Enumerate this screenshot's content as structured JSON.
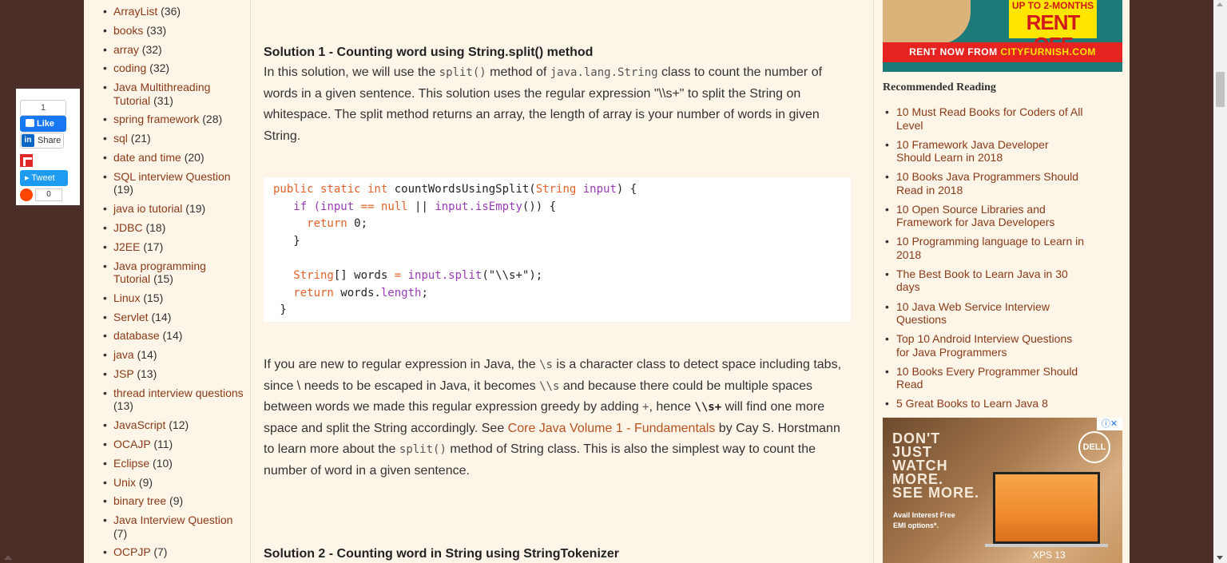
{
  "social": {
    "fb_count": "1",
    "fb_like": "Like",
    "linkedin": "Share",
    "linkedin_icon": "in",
    "tweet": "Tweet",
    "reddit_count": "0"
  },
  "categories": [
    {
      "name": "ArrayList",
      "count": "(36)"
    },
    {
      "name": "books",
      "count": "(33)"
    },
    {
      "name": "array",
      "count": "(32)"
    },
    {
      "name": "coding",
      "count": "(32)"
    },
    {
      "name": "Java Multithreading Tutorial",
      "count": "(31)"
    },
    {
      "name": "spring framework",
      "count": "(28)"
    },
    {
      "name": "sql",
      "count": "(21)"
    },
    {
      "name": "date and time",
      "count": "(20)"
    },
    {
      "name": "SQL interview Question",
      "count": "(19)"
    },
    {
      "name": "java io tutorial",
      "count": "(19)"
    },
    {
      "name": "JDBC",
      "count": "(18)"
    },
    {
      "name": "J2EE",
      "count": "(17)"
    },
    {
      "name": "Java programming Tutorial",
      "count": "(15)"
    },
    {
      "name": "Linux",
      "count": "(15)"
    },
    {
      "name": "Servlet",
      "count": "(14)"
    },
    {
      "name": "database",
      "count": "(14)"
    },
    {
      "name": "java",
      "count": "(14)"
    },
    {
      "name": "JSP",
      "count": "(13)"
    },
    {
      "name": "thread interview questions",
      "count": "(13)"
    },
    {
      "name": "JavaScript",
      "count": "(12)"
    },
    {
      "name": "OCAJP",
      "count": "(11)"
    },
    {
      "name": "Eclipse",
      "count": "(10)"
    },
    {
      "name": "Unix",
      "count": "(9)"
    },
    {
      "name": "binary tree",
      "count": "(9)"
    },
    {
      "name": "Java Interview Question",
      "count": "(7)"
    },
    {
      "name": "OCPJP",
      "count": "(7)"
    }
  ],
  "article": {
    "solution1_title": "Solution 1 - Counting word using String.split() method",
    "p1_a": "In this solution, we will use the ",
    "p1_code1": "split()",
    "p1_b": " method of ",
    "p1_code2": "java.lang.String",
    "p1_c": " class to count the number of words in a given sentence. This solution uses the regular expression \"\\\\s+\" to split the String on whitespace. The split method returns an array, the length of array is your number of words in given String.",
    "code": {
      "l1_a": "public static int",
      "l1_b": " countWordsUsingSplit(",
      "l1_c": "String",
      "l1_d": " input",
      "l1_e": ") {",
      "l2_a": "   if (",
      "l2_b": "input",
      "l2_c": " == ",
      "l2_d": "null",
      "l2_e": " || ",
      "l2_f": "input",
      "l2_g": ".isEmpty",
      "l2_h": "()) {",
      "l3_a": "     return",
      "l3_b": " 0;",
      "l4": "   }",
      "l6_a": "   String",
      "l6_b": "[] words ",
      "l6_c": "=",
      "l6_d": " input",
      "l6_e": ".split",
      "l6_f": "(\"\\\\s+\");",
      "l7_a": "   return",
      "l7_b": " words.",
      "l7_c": "length",
      "l7_d": ";",
      "l8": " }"
    },
    "p2_a": "If you are new to regular expression in Java, the ",
    "p2_code1": "\\s",
    "p2_b": " is a character class to detect space including tabs, since \\ needs to be escaped in Java, it becomes ",
    "p2_code2": "\\\\s",
    "p2_c": " and because there could be multiple spaces between words we made this regular expression greedy by adding ",
    "p2_code3": "+",
    "p2_d": ", hence ",
    "p2_code4": "\\\\s+",
    "p2_e": " will find one more space and split the String accordingly. See ",
    "p2_link": "Core Java Volume 1 - Fundamentals",
    "p2_f": " by Cay S. Horstmann to learn more about the ",
    "p2_code5": "split()",
    "p2_g": " method of String class. This is also the simplest way to count the number of word in a given sentence.",
    "solution2_title": "Solution 2 - Counting word in String using StringTokenizer"
  },
  "ad_top": {
    "line1": "UP TO 2-MONTHS",
    "line2": "RENT OFF",
    "bar_a": "RENT NOW FROM ",
    "bar_b": "CITYFURNISH.COM"
  },
  "recommended": {
    "title": "Recommended Reading",
    "items": [
      "10 Must Read Books for Coders of All Level",
      "10 Framework Java Developer Should Learn in 2018",
      "10 Books Java Programmers Should Read in 2018",
      "10 Open Source Libraries and Framework for Java Developers",
      "10 Programming language to Learn in 2018",
      "The Best Book to Learn Java in 30 days",
      "10 Java Web Service Interview Questions",
      "Top 10 Android Interview Questions for Java Programmers",
      "10 Books Every Programmer Should Read",
      "5 Great Books to Learn Java 8"
    ]
  },
  "ad_bottom": {
    "headline_1": "DON'T",
    "headline_2": "JUST",
    "headline_3": "WATCH",
    "headline_4": "MORE.",
    "headline_5": "SEE MORE.",
    "small_1": "Avail Interest Free",
    "small_2": "EMI options*.",
    "brand": "DELL",
    "model": "XPS 13",
    "adchoices": "ⓘ✕"
  }
}
